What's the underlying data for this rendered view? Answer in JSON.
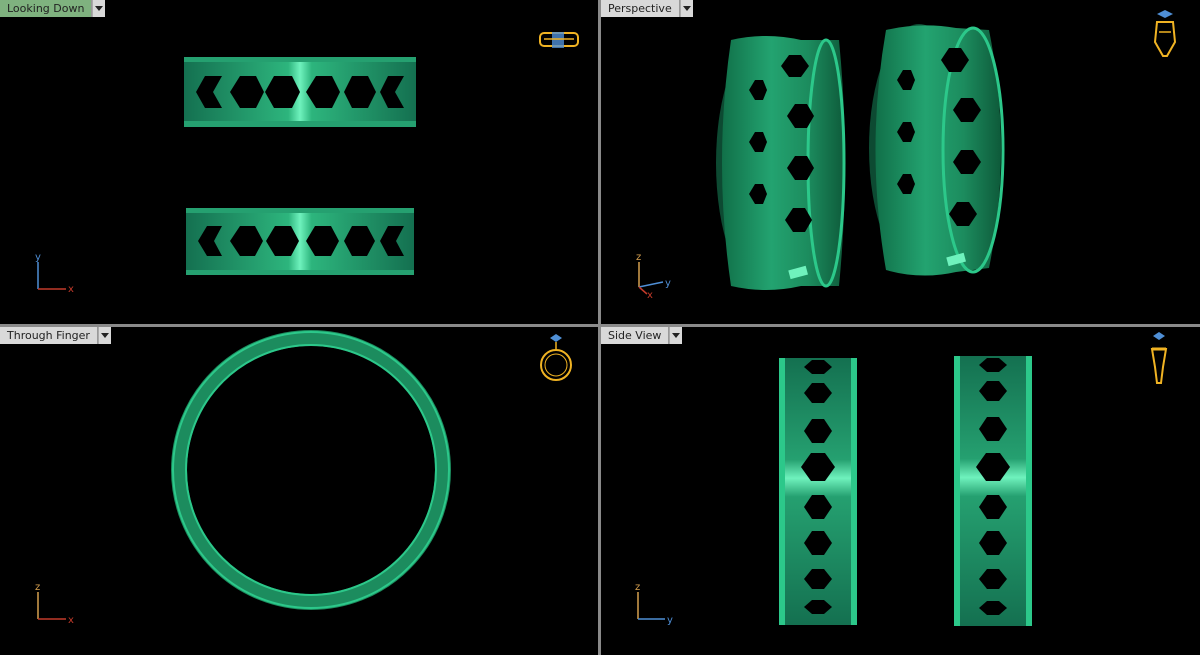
{
  "viewports": [
    {
      "title": "Looking Down",
      "active": true,
      "axes": {
        "vertical": "y",
        "horizontal": "x"
      }
    },
    {
      "title": "Perspective",
      "active": false,
      "axes": {
        "vertical": "z",
        "horizontal": "y",
        "depth": "x"
      }
    },
    {
      "title": "Through Finger",
      "active": false,
      "axes": {
        "vertical": "z",
        "horizontal": "x"
      }
    },
    {
      "title": "Side View",
      "active": false,
      "axes": {
        "vertical": "z",
        "horizontal": "y"
      }
    }
  ],
  "colors": {
    "ring": "#1f8f62",
    "ring_light": "#3fd89a",
    "ring_dark": "#0f5a3c",
    "viewport_bg": "#000000",
    "active_tab": "#7fb27f",
    "tab": "#d9d9d9",
    "icon": "#f0b323",
    "axis_x": "#c23a2a",
    "axis_y": "#4f8fd6",
    "axis_z": "#d6a04f"
  }
}
